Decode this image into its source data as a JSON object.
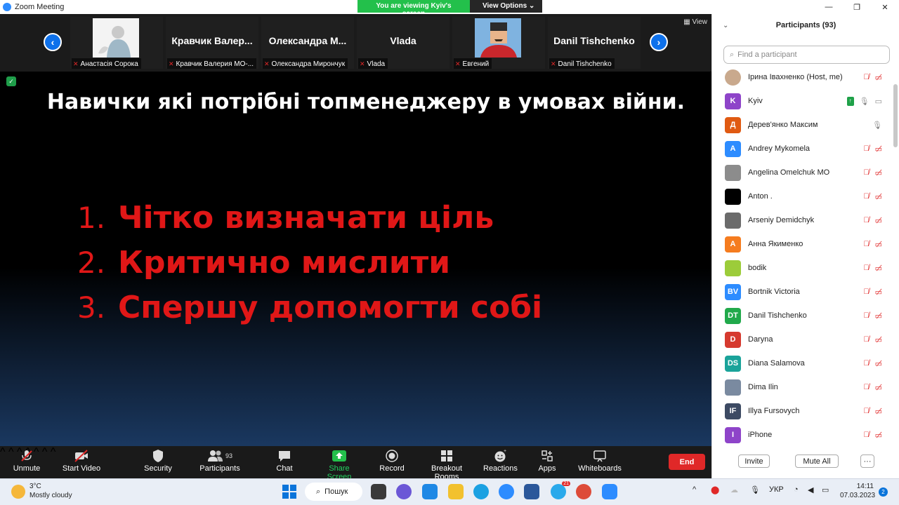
{
  "window": {
    "title": "Zoom Meeting"
  },
  "banner": {
    "viewing": "You are viewing Kyiv's screen",
    "view_options": "View Options ⌄"
  },
  "gallery": {
    "view_label": "View",
    "tiles": [
      {
        "big_name": "",
        "label": "Анастасія Сорока"
      },
      {
        "big_name": "Кравчик Валер...",
        "label": "Кравчик Валерия МО-..."
      },
      {
        "big_name": "Олександра М...",
        "label": "Олександра Мирончук"
      },
      {
        "big_name": "Vlada",
        "label": "Vlada"
      },
      {
        "big_name": "",
        "label": "Евгений"
      },
      {
        "big_name": "Danil Tishchenko",
        "label": "Danil Tishchenko"
      }
    ]
  },
  "slide": {
    "title": "Навички які потрібні топменеджеру в умовах війни.",
    "points": [
      {
        "num": "1.",
        "text": "Чітко визначати ціль"
      },
      {
        "num": "2.",
        "text": "Критично мислити"
      },
      {
        "num": "3.",
        "text": "Спершу допомогти собі"
      }
    ]
  },
  "toolbar": {
    "unmute": "Unmute",
    "start_video": "Start Video",
    "security": "Security",
    "participants": "Participants",
    "participants_count": "93",
    "chat": "Chat",
    "share_screen": "Share Screen",
    "record": "Record",
    "breakout": "Breakout Rooms",
    "reactions": "Reactions",
    "apps": "Apps",
    "whiteboards": "Whiteboards",
    "end": "End"
  },
  "panel": {
    "title": "Participants (93)",
    "search_placeholder": "Find a participant",
    "invite": "Invite",
    "mute_all": "Mute All",
    "more": "···",
    "participants": [
      {
        "initials": "",
        "name": "Ірина Івахненко (Host, me)",
        "color": "#c9a98d"
      },
      {
        "initials": "K",
        "name": "Kyiv",
        "color": "#8e44c9"
      },
      {
        "initials": "Д",
        "name": "Дерев'янко Максим",
        "color": "#e05a12"
      },
      {
        "initials": "A",
        "name": "Andrey Mykomela",
        "color": "#2d8cff"
      },
      {
        "initials": "",
        "name": "Angelina Omelchuk MO",
        "color": "#8c8c8c"
      },
      {
        "initials": "",
        "name": "Anton .",
        "color": "#000000"
      },
      {
        "initials": "",
        "name": "Arseniy Demidchyk",
        "color": "#6b6b6b"
      },
      {
        "initials": "A",
        "name": "Анна Якименко",
        "color": "#f57c1f"
      },
      {
        "initials": "",
        "name": "bodik",
        "color": "#9ccc3a"
      },
      {
        "initials": "BV",
        "name": "Bortnik Victoria",
        "color": "#2d8cff"
      },
      {
        "initials": "DT",
        "name": "Danil Tishchenko",
        "color": "#21a94b"
      },
      {
        "initials": "D",
        "name": "Daryna",
        "color": "#d63a2f"
      },
      {
        "initials": "DS",
        "name": "Diana Salamova",
        "color": "#1aa39a"
      },
      {
        "initials": "",
        "name": "Dima Ilin",
        "color": "#7a8aa0"
      },
      {
        "initials": "IF",
        "name": "Illya Fursovych",
        "color": "#3d4a63"
      },
      {
        "initials": "I",
        "name": "iPhone",
        "color": "#8e44c9"
      }
    ]
  },
  "taskbar": {
    "temp": "3°C",
    "weather": "Mostly cloudy",
    "search": "Пошук",
    "lang": "УКР",
    "time": "14:11",
    "date": "07.03.2023",
    "notifications": "2",
    "telegram_badge": "21"
  }
}
